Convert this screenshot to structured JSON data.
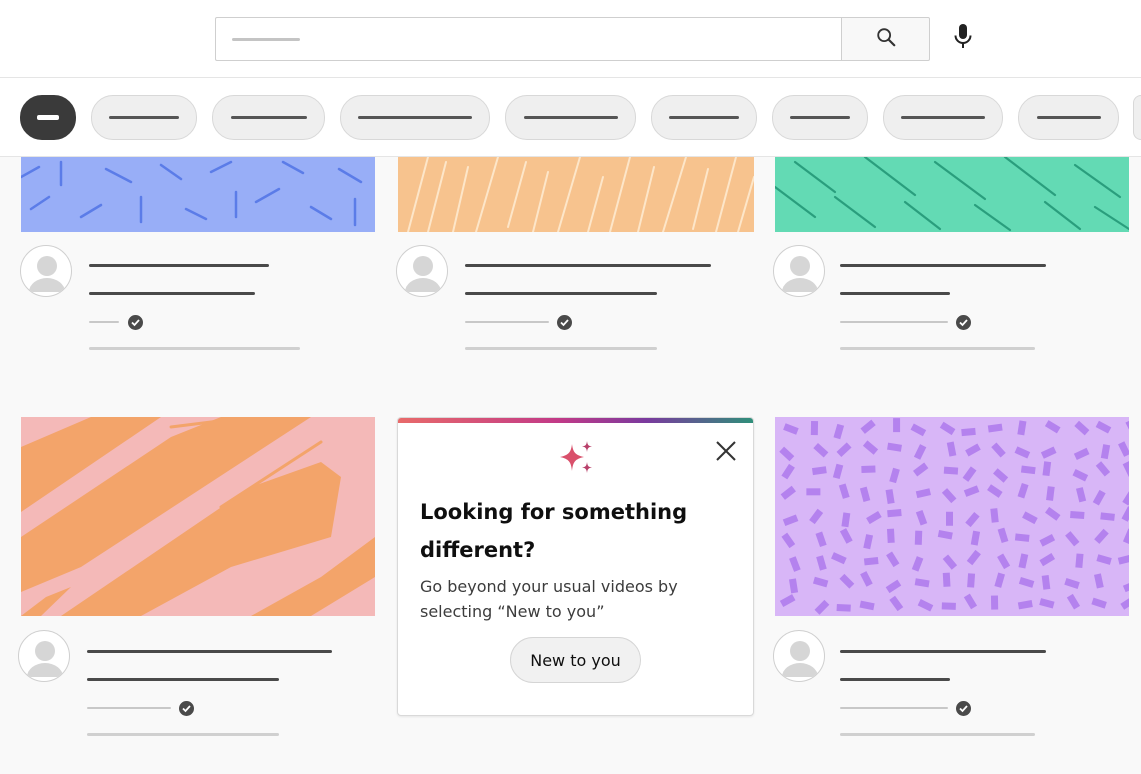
{
  "search": {
    "placeholder": ""
  },
  "icons": {
    "search": "search-icon",
    "mic": "microphone-icon",
    "close": "close-icon",
    "sparkle": "sparkle-icon",
    "verified": "verified-check-icon",
    "avatar": "avatar-icon"
  },
  "chips": {
    "count": 10,
    "active_index": 0
  },
  "promo": {
    "title": "Looking for something different?",
    "text": "Go beyond your usual videos by selecting “New to you”",
    "button_label": "New to you"
  },
  "colors": {
    "thumb_blue": "#98aef7",
    "thumb_orange": "#f7c38e",
    "thumb_green": "#63dab4",
    "thumb_pink": "#f4b9b8",
    "thumb_pink_stroke": "#f3a46a",
    "thumb_purple": "#d8b6f7",
    "thumb_purple_mark": "#b482ee",
    "promo_sparkle": "#c0405a"
  }
}
